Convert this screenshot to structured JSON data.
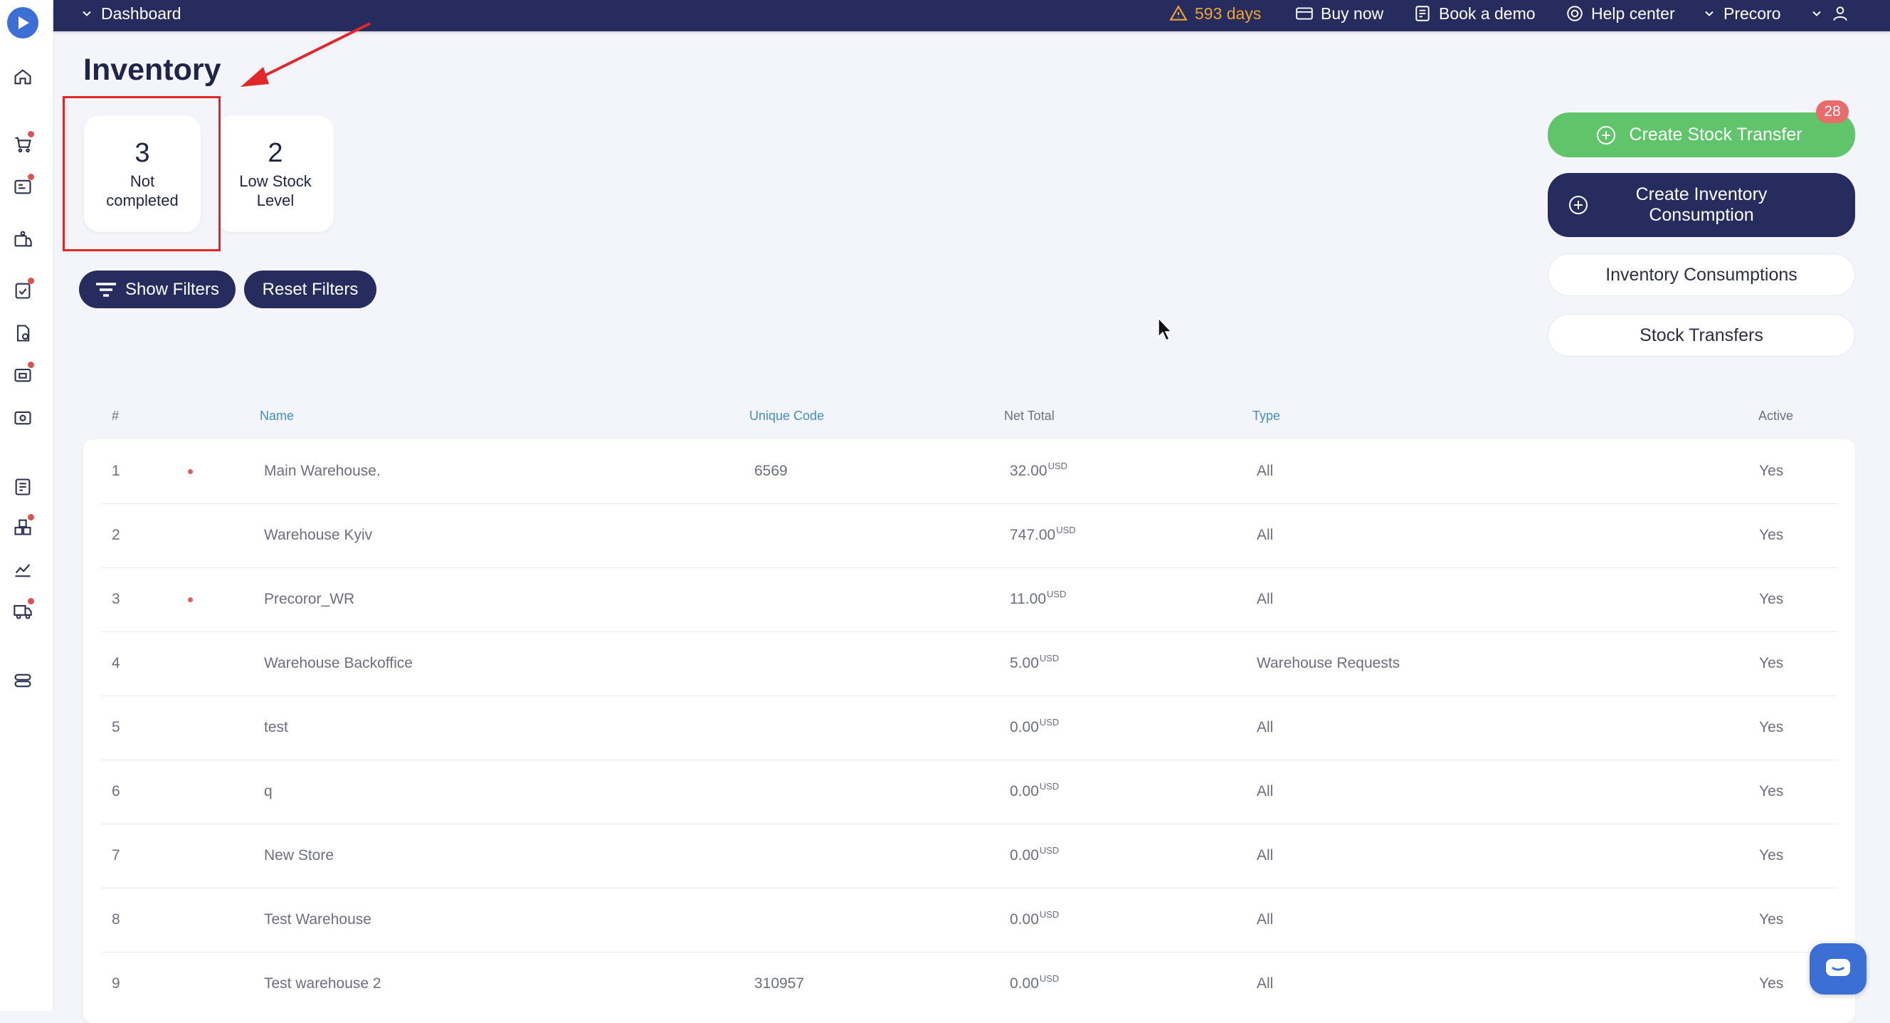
{
  "topbar": {
    "dashboard": "Dashboard",
    "trial": "593 days",
    "buy_now": "Buy now",
    "book_demo": "Book a demo",
    "help_center": "Help center",
    "company": "Precoro"
  },
  "page": {
    "title": "Inventory"
  },
  "kpis": [
    {
      "value": "3",
      "label": "Not completed"
    },
    {
      "value": "2",
      "label": "Low Stock Level"
    }
  ],
  "filters": {
    "show": "Show Filters",
    "reset": "Reset Filters"
  },
  "actions": {
    "create_transfer": "Create Stock Transfer",
    "transfer_badge": "28",
    "create_consumption": "Create Inventory Consumption",
    "consumptions": "Inventory Consumptions",
    "transfers": "Stock Transfers"
  },
  "table": {
    "headers": {
      "num": "#",
      "name": "Name",
      "code": "Unique Code",
      "net": "Net Total",
      "type": "Type",
      "active": "Active"
    },
    "currency": "USD",
    "rows": [
      {
        "num": "1",
        "name": "Main Warehouse.",
        "code": "6569",
        "net": "32.00",
        "type": "All",
        "active": "Yes"
      },
      {
        "num": "2",
        "name": "Warehouse Kyiv",
        "code": "",
        "net": "747.00",
        "type": "All",
        "active": "Yes"
      },
      {
        "num": "3",
        "name": "Precoror_WR",
        "code": "",
        "net": "11.00",
        "type": "All",
        "active": "Yes"
      },
      {
        "num": "4",
        "name": "Warehouse Backoffice",
        "code": "",
        "net": "5.00",
        "type": "Warehouse Requests",
        "active": "Yes"
      },
      {
        "num": "5",
        "name": "test",
        "code": "",
        "net": "0.00",
        "type": "All",
        "active": "Yes"
      },
      {
        "num": "6",
        "name": "q",
        "code": "",
        "net": "0.00",
        "type": "All",
        "active": "Yes"
      },
      {
        "num": "7",
        "name": "New Store",
        "code": "",
        "net": "0.00",
        "type": "All",
        "active": "Yes"
      },
      {
        "num": "8",
        "name": "Test Warehouse",
        "code": "",
        "net": "0.00",
        "type": "All",
        "active": "Yes"
      },
      {
        "num": "9",
        "name": "Test warehouse 2",
        "code": "310957",
        "net": "0.00",
        "type": "All",
        "active": "Yes"
      }
    ]
  },
  "colors": {
    "navy": "#272c5e",
    "green": "#5fc46a",
    "warn": "#f0a430",
    "annotation": "#e0282b"
  }
}
